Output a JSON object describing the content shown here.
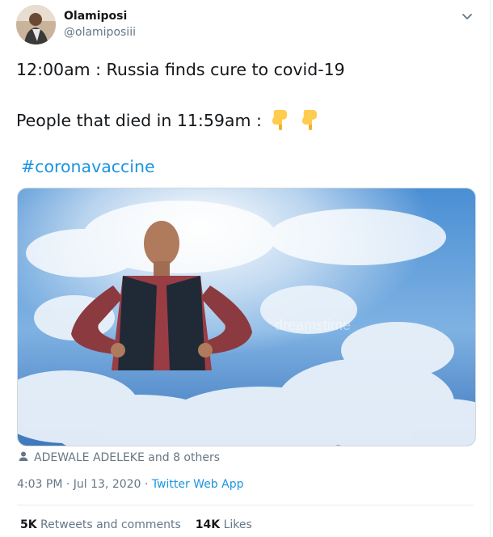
{
  "user": {
    "display_name": "Olamiposi",
    "handle": "@olamiposiii"
  },
  "tweet": {
    "line1": "12:00am : Russia finds cure to covid-19",
    "line2": "People that died in 11:59am :",
    "emoji": [
      "pointing-down-emoji",
      "pointing-down-emoji"
    ],
    "hashtag": "#coronavaccine"
  },
  "media": {
    "description_icon": "man-in-clouds-image",
    "watermark": "dreamstime"
  },
  "tagged": {
    "text": "ADEWALE ADELEKE and 8 others"
  },
  "meta": {
    "time_date": "4:03 PM · Jul 13, 2020 · ",
    "app": "Twitter Web App"
  },
  "stats": {
    "retweets_count": "5K",
    "retweets_label": "Retweets and comments",
    "likes_count": "14K",
    "likes_label": "Likes"
  },
  "colors": {
    "link": "#1b95e0",
    "secondary": "#657786",
    "primary_text": "#14171a",
    "sky": "#3d7fc4"
  }
}
